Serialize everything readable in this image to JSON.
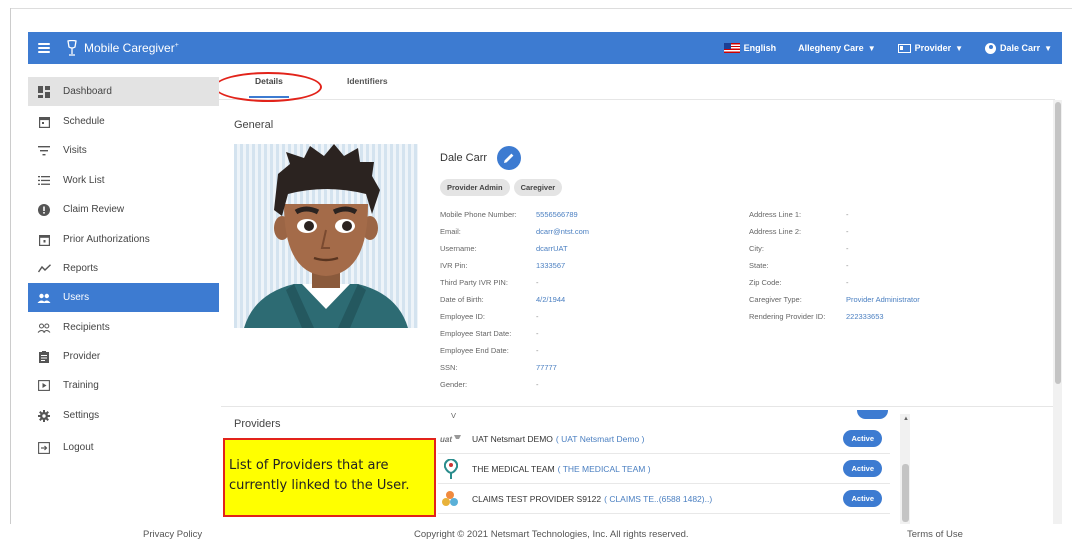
{
  "app": {
    "title": "Mobile Caregiver",
    "title_mark": "+",
    "language": "English",
    "agency": "Allegheny Care",
    "role": "Provider",
    "user": "Dale Carr"
  },
  "sidebar": {
    "items": [
      {
        "label": "Dashboard",
        "icon": "dashboard-icon"
      },
      {
        "label": "Schedule",
        "icon": "calendar-icon"
      },
      {
        "label": "Visits",
        "icon": "filter-icon"
      },
      {
        "label": "Work List",
        "icon": "list-icon"
      },
      {
        "label": "Claim Review",
        "icon": "alert-icon"
      },
      {
        "label": "Prior Authorizations",
        "icon": "calendar-check-icon"
      },
      {
        "label": "Reports",
        "icon": "chart-line-icon"
      },
      {
        "label": "Users",
        "icon": "users-icon"
      },
      {
        "label": "Recipients",
        "icon": "people-outline-icon"
      },
      {
        "label": "Provider",
        "icon": "clipboard-icon"
      },
      {
        "label": "Training",
        "icon": "training-icon"
      },
      {
        "label": "Settings",
        "icon": "gear-icon"
      },
      {
        "label": "Logout",
        "icon": "logout-icon"
      }
    ]
  },
  "tabs": [
    {
      "label": "Details"
    },
    {
      "label": "Identifiers"
    }
  ],
  "general": {
    "section_title": "General",
    "name": "Dale Carr",
    "chips": [
      "Provider Admin",
      "Caregiver"
    ],
    "left_fields": [
      {
        "label": "Mobile Phone Number:",
        "value": "5556566789"
      },
      {
        "label": "Email:",
        "value": "dcarr@ntst.com"
      },
      {
        "label": "Username:",
        "value": "dcarrUAT"
      },
      {
        "label": "IVR Pin:",
        "value": "1333567"
      },
      {
        "label": "Third Party IVR PIN:",
        "value": "-"
      },
      {
        "label": "Date of Birth:",
        "value": "4/2/1944"
      },
      {
        "label": "Employee ID:",
        "value": "-"
      },
      {
        "label": "Employee Start Date:",
        "value": "-"
      },
      {
        "label": "Employee End Date:",
        "value": "-"
      },
      {
        "label": "SSN:",
        "value": "77777"
      },
      {
        "label": "Gender:",
        "value": "-"
      }
    ],
    "right_fields": [
      {
        "label": "Address Line 1:",
        "value": "-"
      },
      {
        "label": "Address Line 2:",
        "value": "-"
      },
      {
        "label": "City:",
        "value": "-"
      },
      {
        "label": "State:",
        "value": "-"
      },
      {
        "label": "Zip Code:",
        "value": "-"
      },
      {
        "label": "Caregiver Type:",
        "value": "Provider Administrator"
      },
      {
        "label": "Rendering Provider ID:",
        "value": "222333653"
      }
    ]
  },
  "providers": {
    "section_title": "Providers",
    "header_fragment": "V",
    "rows": [
      {
        "name": "UAT Netsmart DEMO",
        "code": "( UAT Netsmart Demo )",
        "status": "Active",
        "logo": "uat-logo-icon"
      },
      {
        "name": "THE MEDICAL TEAM",
        "code": "( THE MEDICAL TEAM )",
        "status": "Active",
        "logo": "medical-team-logo-icon"
      },
      {
        "name": "CLAIMS TEST PROVIDER S9122",
        "code": "( CLAIMS TE..(6588 1482)..)",
        "status": "Active",
        "logo": "claims-logo-icon"
      }
    ]
  },
  "callout": {
    "text": "List of Providers that are currently linked to the User."
  },
  "footer": {
    "privacy": "Privacy Policy",
    "copyright": "Copyright © 2021 Netsmart Technologies, Inc. All rights reserved.",
    "terms": "Terms of Use"
  },
  "colors": {
    "primary": "#3d7bd1",
    "highlight": "#ffff00",
    "annotation_red": "#e2231a"
  }
}
